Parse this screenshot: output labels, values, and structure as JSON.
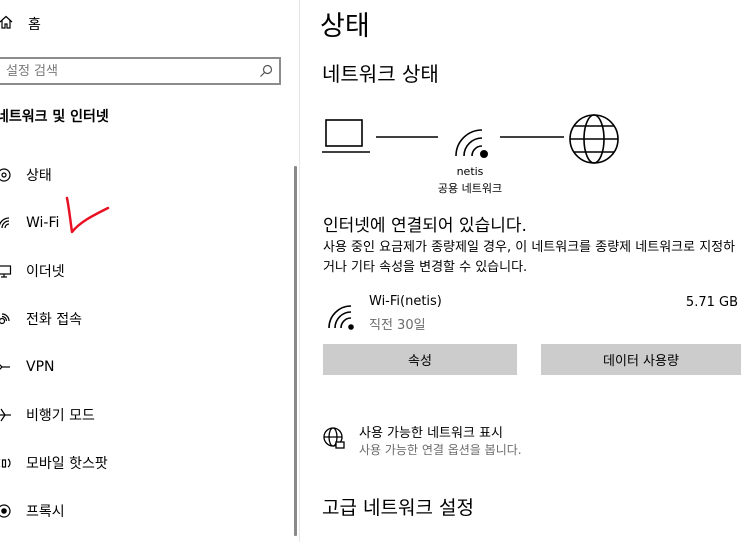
{
  "nav": {
    "home_label": "홈",
    "search_placeholder": "설정 검색",
    "section_title": "네트워크 및 인터넷",
    "items": [
      {
        "label": "상태",
        "icon": "status-icon"
      },
      {
        "label": "Wi-Fi",
        "icon": "wifi-icon"
      },
      {
        "label": "이더넷",
        "icon": "ethernet-icon"
      },
      {
        "label": "전화 접속",
        "icon": "dialup-icon"
      },
      {
        "label": "VPN",
        "icon": "vpn-icon"
      },
      {
        "label": "비행기 모드",
        "icon": "airplane-icon"
      },
      {
        "label": "모바일 핫스팟",
        "icon": "hotspot-icon"
      },
      {
        "label": "프록시",
        "icon": "proxy-icon"
      }
    ],
    "annotation_color": "#e81123"
  },
  "main": {
    "title": "상태",
    "subtitle": "네트워크 상태",
    "network_name": "netis",
    "network_type": "공용 네트워크",
    "connected_title": "인터넷에 연결되어 있습니다.",
    "connected_desc": "사용 중인 요금제가 종량제일 경우, 이 네트워크를 종량제 네트워크로 지정하거나 기타 속성을 변경할 수 있습니다.",
    "connection": {
      "name": "Wi-Fi(netis)",
      "time": "직전 30일",
      "usage": "5.71 GB"
    },
    "buttons": {
      "properties": "속성",
      "data_usage": "데이터 사용량"
    },
    "show_networks": {
      "title": "사용 가능한 네트워크 표시",
      "desc": "사용 가능한 연결 옵션을 봅니다."
    },
    "advanced_title": "고급 네트워크 설정"
  }
}
